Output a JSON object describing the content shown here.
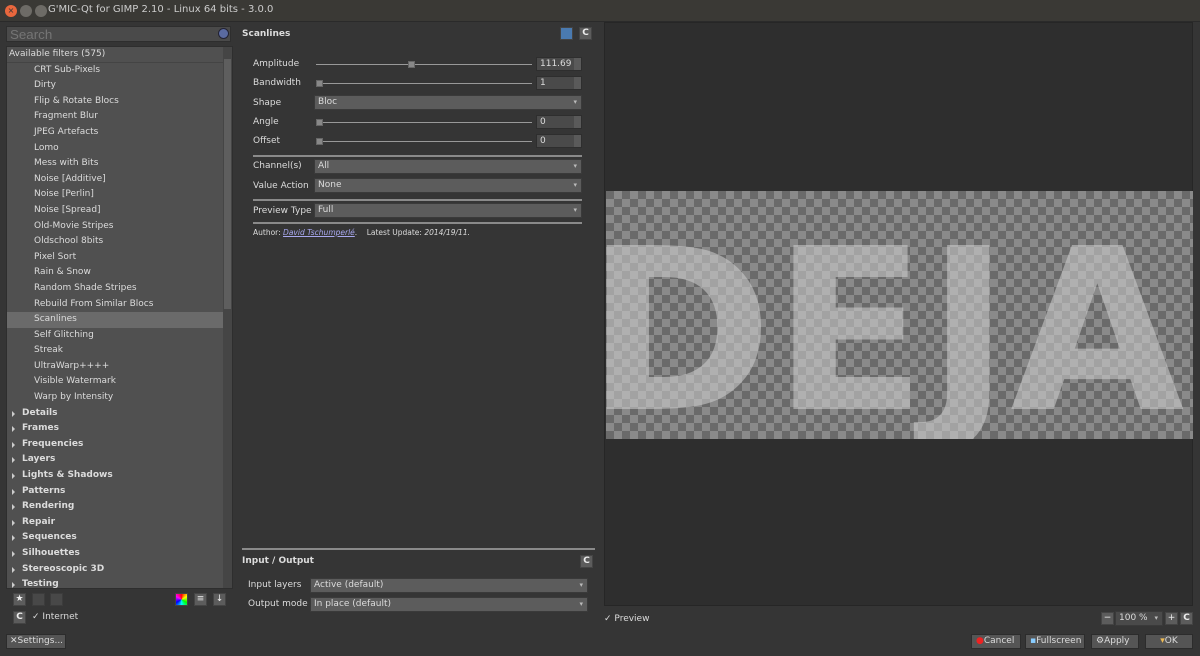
{
  "window": {
    "title": "G'MIC-Qt for GIMP 2.10 - Linux 64 bits - 3.0.0"
  },
  "search": {
    "placeholder": "Search"
  },
  "tree": {
    "header": "Available filters (575)",
    "items": [
      "CRT Sub-Pixels",
      "Dirty",
      "Flip & Rotate Blocs",
      "Fragment Blur",
      "JPEG Artefacts",
      "Lomo",
      "Mess with Bits",
      "Noise [Additive]",
      "Noise [Perlin]",
      "Noise [Spread]",
      "Old-Movie Stripes",
      "Oldschool 8bits",
      "Pixel Sort",
      "Rain & Snow",
      "Random Shade Stripes",
      "Rebuild From Similar Blocs",
      "Scanlines",
      "Self Glitching",
      "Streak",
      "UltraWarp++++",
      "Visible Watermark",
      "Warp by Intensity"
    ],
    "selected": "Scanlines",
    "categories": [
      "Details",
      "Frames",
      "Frequencies",
      "Layers",
      "Lights & Shadows",
      "Patterns",
      "Rendering",
      "Repair",
      "Sequences",
      "Silhouettes",
      "Stereoscopic 3D",
      "Testing"
    ]
  },
  "left_bottom": {
    "internet_label": "Internet",
    "internet_checked": true,
    "settings_label": "Settings..."
  },
  "filter": {
    "title": "Scanlines",
    "amplitude": {
      "label": "Amplitude",
      "value": "111.69",
      "fraction": 0.44
    },
    "bandwidth": {
      "label": "Bandwidth",
      "value": "1",
      "fraction": 0
    },
    "shape": {
      "label": "Shape",
      "value": "Bloc"
    },
    "angle": {
      "label": "Angle",
      "value": "0",
      "fraction": 0
    },
    "offset": {
      "label": "Offset",
      "value": "0",
      "fraction": 0
    },
    "channels": {
      "label": "Channel(s)",
      "value": "All"
    },
    "value_action": {
      "label": "Value Action",
      "value": "None"
    },
    "preview_type": {
      "label": "Preview Type",
      "value": "Full"
    },
    "author_label": "Author:",
    "author": "David Tschumperlé",
    "update_label": "Latest Update:",
    "update": "2014/19/11."
  },
  "io": {
    "title": "Input / Output",
    "input_label": "Input layers",
    "input_value": "Active (default)",
    "output_label": "Output mode",
    "output_value": "In place (default)"
  },
  "preview": {
    "label": "Preview",
    "checked": true,
    "zoom": "100 %",
    "image_text": "DEJA VU"
  },
  "buttons": {
    "cancel": "Cancel",
    "fullscreen": "Fullscreen",
    "apply": "Apply",
    "ok": "OK"
  }
}
